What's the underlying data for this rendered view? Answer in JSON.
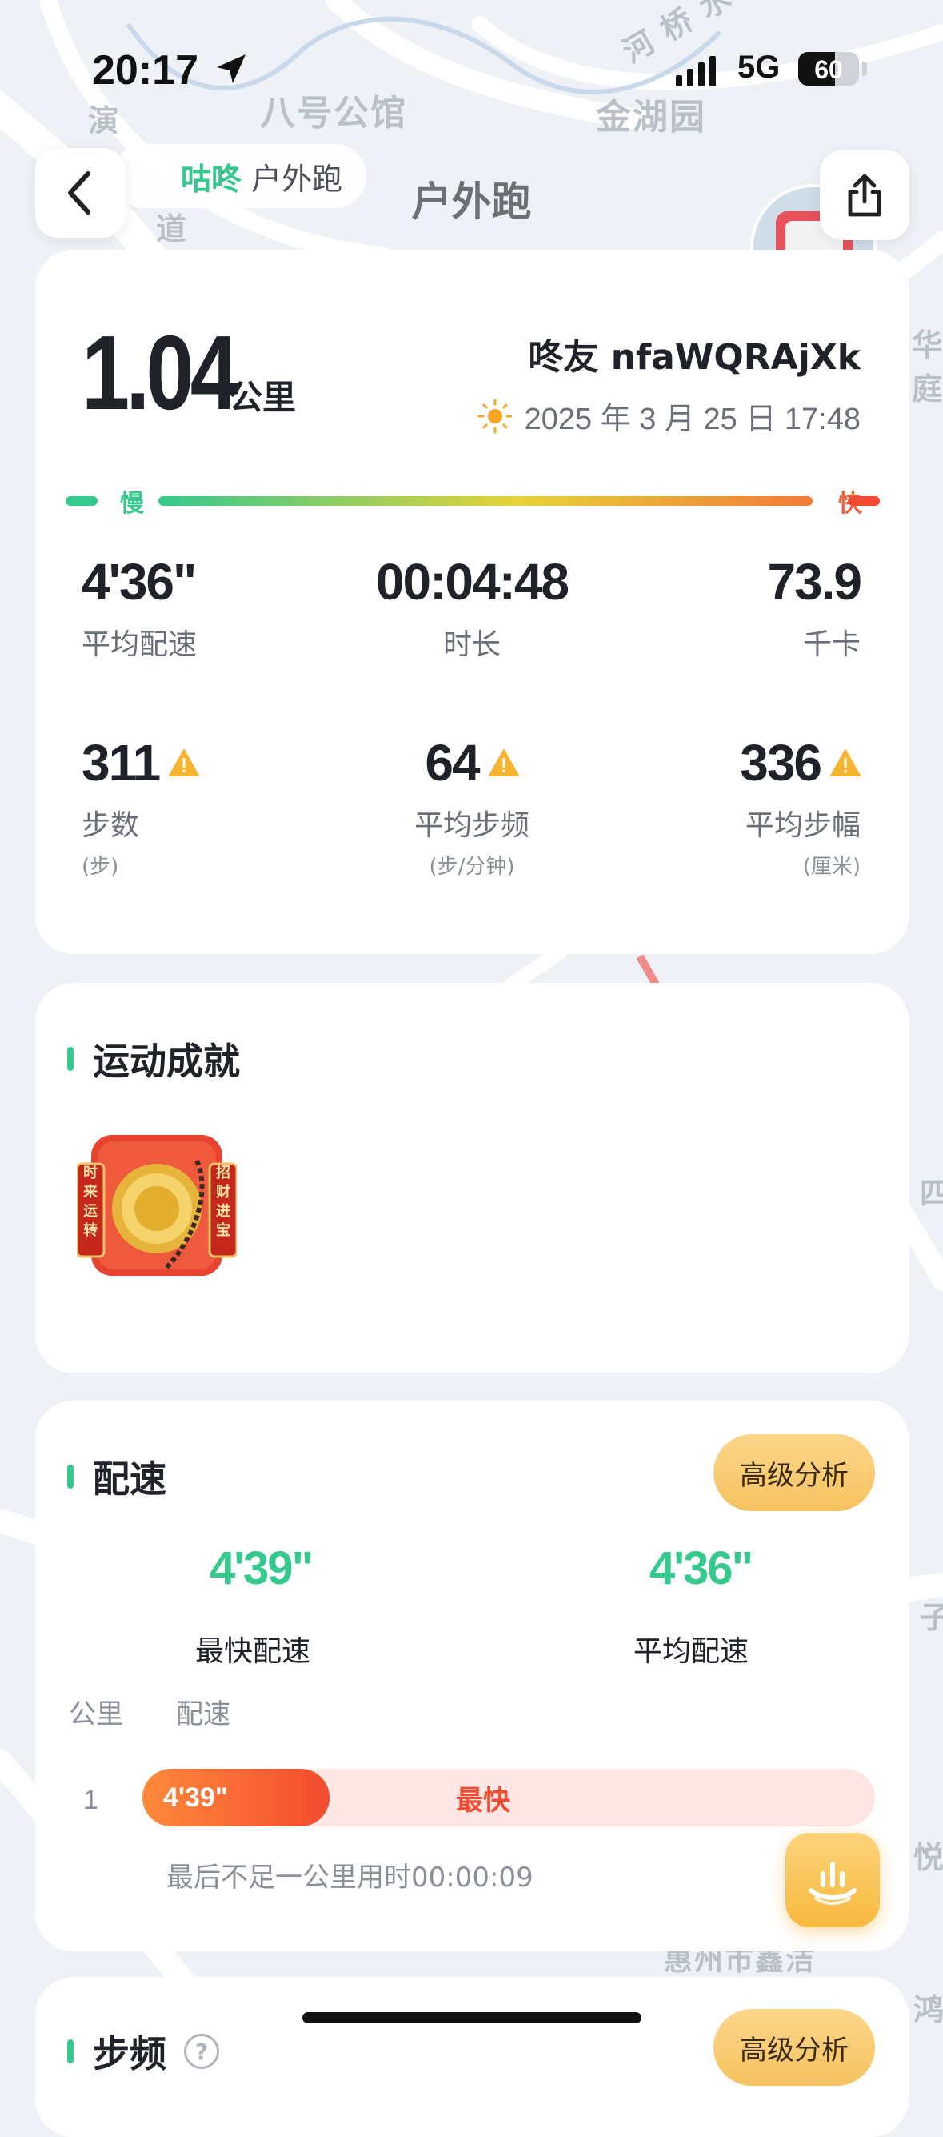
{
  "status": {
    "time": "20:17",
    "network": "5G",
    "battery": "60",
    "battery_level": 0.6
  },
  "map": {
    "labels": [
      "八号公馆",
      "金湖园",
      "河 桥 水",
      "演",
      "道",
      "惠州市鑫洁",
      "华庭",
      "四",
      "悦",
      "鸿",
      "子"
    ]
  },
  "nav": {
    "brand": "咕咚",
    "brand_sub": "户外跑",
    "title": "户外跑",
    "back_icon": "chevron-left-icon",
    "share_icon": "share-icon"
  },
  "summary": {
    "distance": "1.04",
    "distance_unit": "公里",
    "user": "咚友 nfaWQRAjXk",
    "date": "2025 年 3 月 25 日 17:48",
    "weather_icon": "sun-icon",
    "slow_label": "慢",
    "fast_label": "快",
    "stats_top": [
      {
        "value": "4'36\"",
        "label": "平均配速"
      },
      {
        "value": "00:04:48",
        "label": "时长"
      },
      {
        "value": "73.9",
        "label": "千卡"
      }
    ],
    "stats_bottom": [
      {
        "value": "311",
        "label": "步数",
        "sub": "(步)"
      },
      {
        "value": "64",
        "label": "平均步频",
        "sub": "(步/分钟)"
      },
      {
        "value": "336",
        "label": "平均步幅",
        "sub": "(厘米)"
      }
    ]
  },
  "achievement": {
    "title": "运动成就",
    "medal": {
      "left_text": "时来运转",
      "right_text": "招财进宝"
    }
  },
  "pace": {
    "title": "配速",
    "advanced_label": "高级分析",
    "fastest": {
      "value": "4'39\"",
      "label": "最快配速"
    },
    "average": {
      "value": "4'36\"",
      "label": "平均配速"
    },
    "col_km": "公里",
    "col_pace": "配速",
    "rows": [
      {
        "km": "1",
        "pace": "4'39\"",
        "tag": "最快",
        "fraction": 0.255
      }
    ],
    "note": "最后不足一公里用时00:00:09"
  },
  "cadence": {
    "title": "步频",
    "advanced_label": "高级分析",
    "help": "?"
  },
  "colors": {
    "accent": "#35c98d",
    "fast": "#f34b2f",
    "gold": "#f6c260"
  }
}
